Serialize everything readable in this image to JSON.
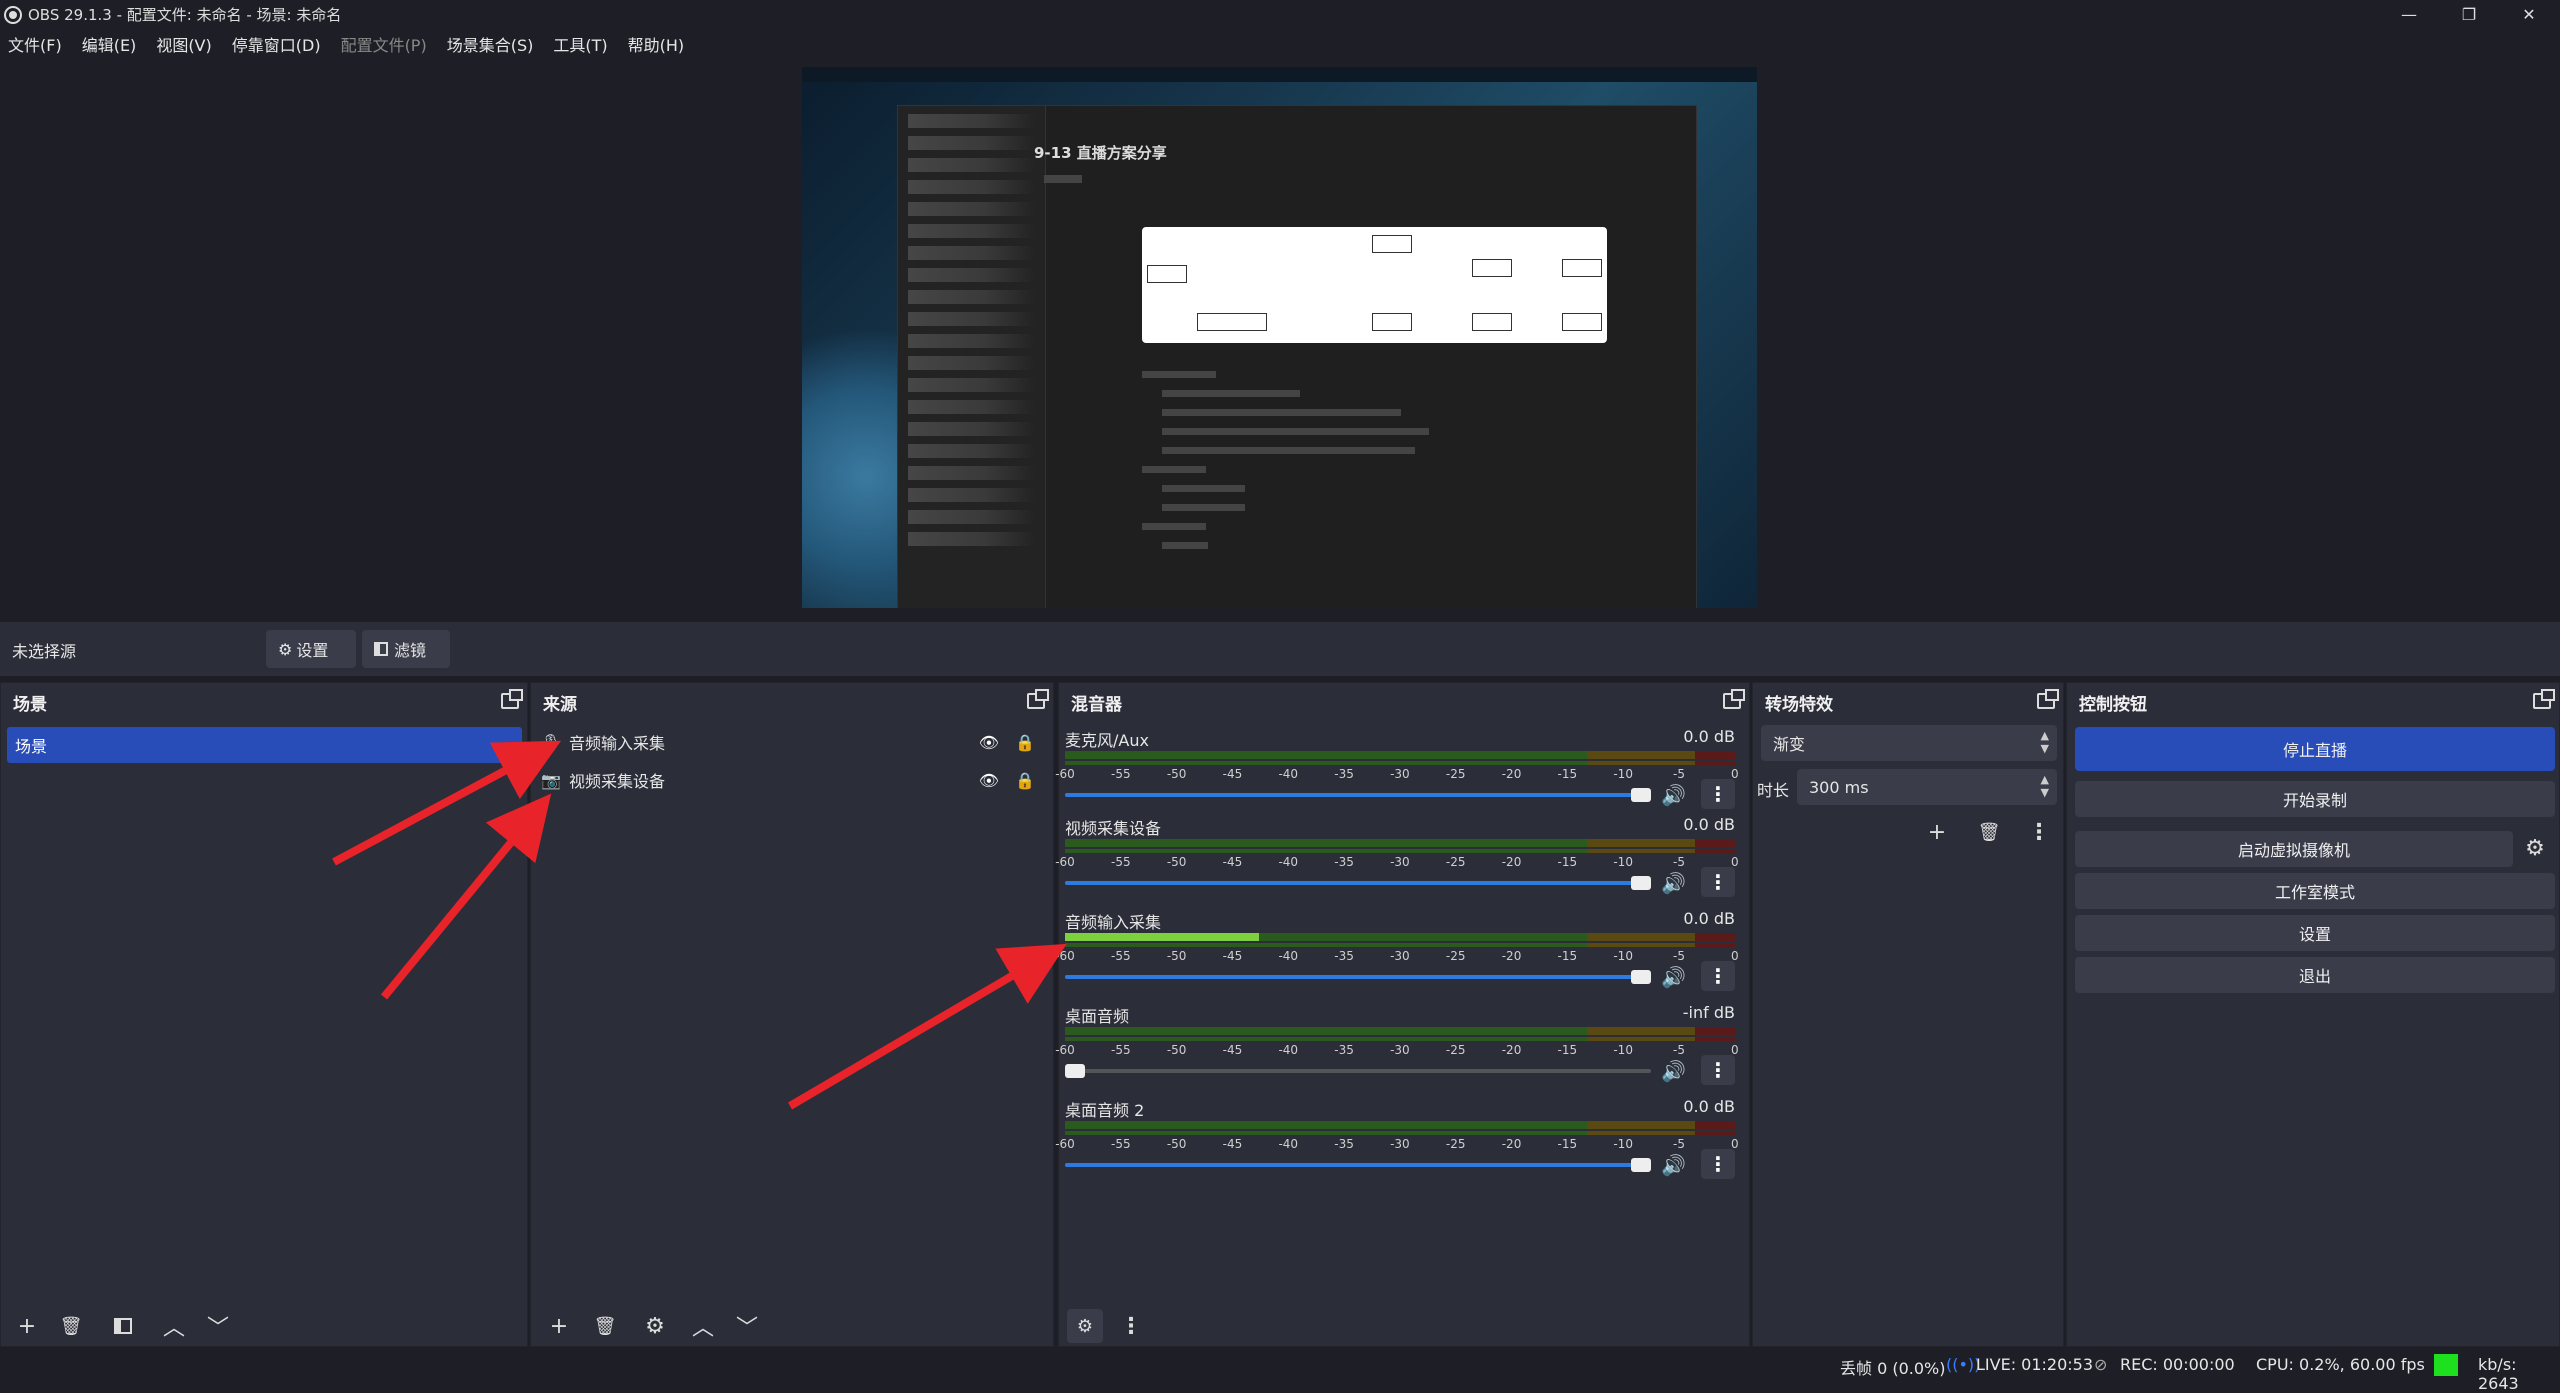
{
  "window": {
    "title": "OBS 29.1.3 - 配置文件: 未命名 - 场景: 未命名",
    "minimize": "—",
    "maximize": "❐",
    "close": "✕"
  },
  "menu": [
    "文件(F)",
    "编辑(E)",
    "视图(V)",
    "停靠窗口(D)",
    "配置文件(P)",
    "场景集合(S)",
    "工具(T)",
    "帮助(H)"
  ],
  "preview": {
    "doc_title": "9-13 直播方案分享"
  },
  "toolbar": {
    "no_source": "未选择源",
    "settings": "设置",
    "filters": "滤镜"
  },
  "scenes": {
    "title": "场景",
    "items": [
      "场景"
    ]
  },
  "sources": {
    "title": "来源",
    "items": [
      {
        "label": "音频输入采集",
        "icon": "microphone-icon"
      },
      {
        "label": "视频采集设备",
        "icon": "camera-icon"
      }
    ]
  },
  "mixer": {
    "title": "混音器",
    "ticks": [
      "-60",
      "-55",
      "-50",
      "-45",
      "-40",
      "-35",
      "-30",
      "-25",
      "-20",
      "-15",
      "-10",
      "-5",
      "0"
    ],
    "channels": [
      {
        "name": "麦克风/Aux",
        "db": "0.0 dB",
        "volume": 1.0,
        "level": 0.0,
        "muted": false
      },
      {
        "name": "视频采集设备",
        "db": "0.0 dB",
        "volume": 1.0,
        "level": 0.0,
        "muted": false
      },
      {
        "name": "音频输入采集",
        "db": "0.0 dB",
        "volume": 1.0,
        "level": 0.29,
        "muted": false
      },
      {
        "name": "桌面音频",
        "db": "-inf dB",
        "volume": 0.0,
        "level": 0.0,
        "muted": false
      },
      {
        "name": "桌面音频 2",
        "db": "0.0 dB",
        "volume": 1.0,
        "level": 0.0,
        "muted": false
      }
    ]
  },
  "transitions": {
    "title": "转场特效",
    "selected": "渐变",
    "duration_label": "时长",
    "duration": "300 ms"
  },
  "controls": {
    "title": "控制按钮",
    "stop_stream": "停止直播",
    "start_record": "开始录制",
    "virtual_cam": "启动虚拟摄像机",
    "studio_mode": "工作室模式",
    "settings": "设置",
    "exit": "退出"
  },
  "status": {
    "dropped": "丢帧 0 (0.0%)",
    "live": "LIVE: 01:20:53",
    "rec": "REC: 00:00:00",
    "cpu": "CPU: 0.2%, 60.00 fps",
    "kbps": "kb/s: 2643"
  },
  "colors": {
    "accent": "#284cb8",
    "arrow": "#e8232a",
    "status_ok": "#1ee01e"
  }
}
